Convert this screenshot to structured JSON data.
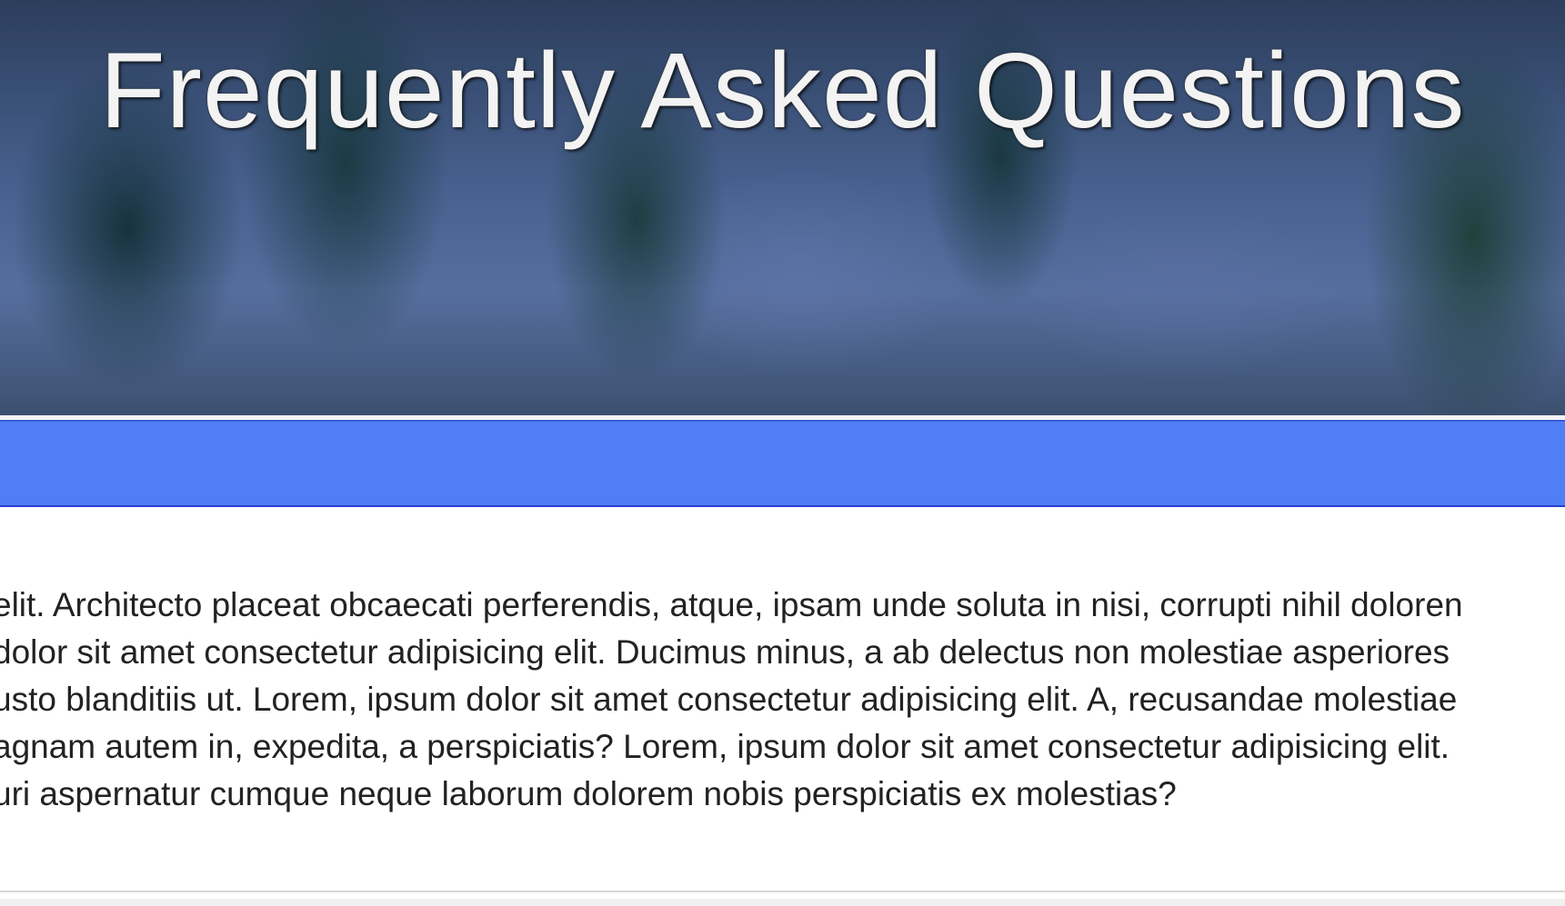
{
  "hero": {
    "title": "Frequently Asked Questions"
  },
  "nav": {
    "background_color": "#4f7ef6"
  },
  "content": {
    "lines": [
      "elit. Architecto placeat obcaecati perferendis, atque, ipsam unde soluta in nisi, corrupti nihil doloren",
      "dolor sit amet consectetur adipisicing elit. Ducimus minus, a ab delectus non molestiae asperiores",
      "usto blanditiis ut. Lorem, ipsum dolor sit amet consectetur adipisicing elit. A, recusandae molestiae",
      "agnam autem in, expedita, a perspiciatis? Lorem, ipsum dolor sit amet consectetur adipisicing elit.",
      "uri aspernatur cumque neque laborum dolorem nobis perspiciatis ex molestias?"
    ]
  }
}
